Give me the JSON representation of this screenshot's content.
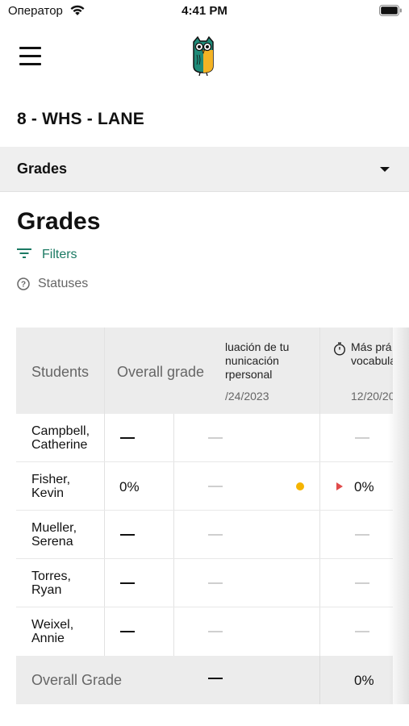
{
  "status_bar": {
    "carrier": "Оператор",
    "time": "4:41 PM"
  },
  "header": {
    "menu_icon": "hamburger-icon",
    "logo": "owl-logo"
  },
  "class_title": "8 - WHS - LANE",
  "section_selector": {
    "label": "Grades"
  },
  "page_title": "Grades",
  "filters_label": "Filters",
  "statuses_label": "Statuses",
  "table": {
    "col_students": "Students",
    "col_overall": "Overall grade",
    "assignments": [
      {
        "title_lines": [
          "luación de tu",
          "nunicación",
          "rpersonal"
        ],
        "date": "/24/2023"
      },
      {
        "title_lines": [
          "Más prá",
          "vocabula"
        ],
        "date": "12/20/20",
        "icon": "timer-icon"
      }
    ],
    "rows": [
      {
        "name_lines": [
          "Campbell,",
          "Catherine"
        ],
        "overall": "—",
        "a1": "—",
        "a2": "—"
      },
      {
        "name_lines": [
          "Fisher,",
          "Kevin"
        ],
        "overall": "0%",
        "a1": "—",
        "a2": "0%",
        "a1_status": "yellow-dot",
        "a2_status": "late-flag"
      },
      {
        "name_lines": [
          "Mueller,",
          "Serena"
        ],
        "overall": "—",
        "a1": "—",
        "a2": "—"
      },
      {
        "name_lines": [
          "Torres,",
          "Ryan"
        ],
        "overall": "—",
        "a1": "—",
        "a2": "—"
      },
      {
        "name_lines": [
          "Weixel,",
          "Annie"
        ],
        "overall": "—",
        "a1": "—",
        "a2": "—"
      }
    ],
    "footer": {
      "label": "Overall Grade",
      "a1": "—",
      "a2": "0%"
    }
  },
  "colors": {
    "accent": "#1b7a63",
    "status_yellow": "#f5b400",
    "late_red": "#e04a4a",
    "header_gray": "#ececec"
  }
}
